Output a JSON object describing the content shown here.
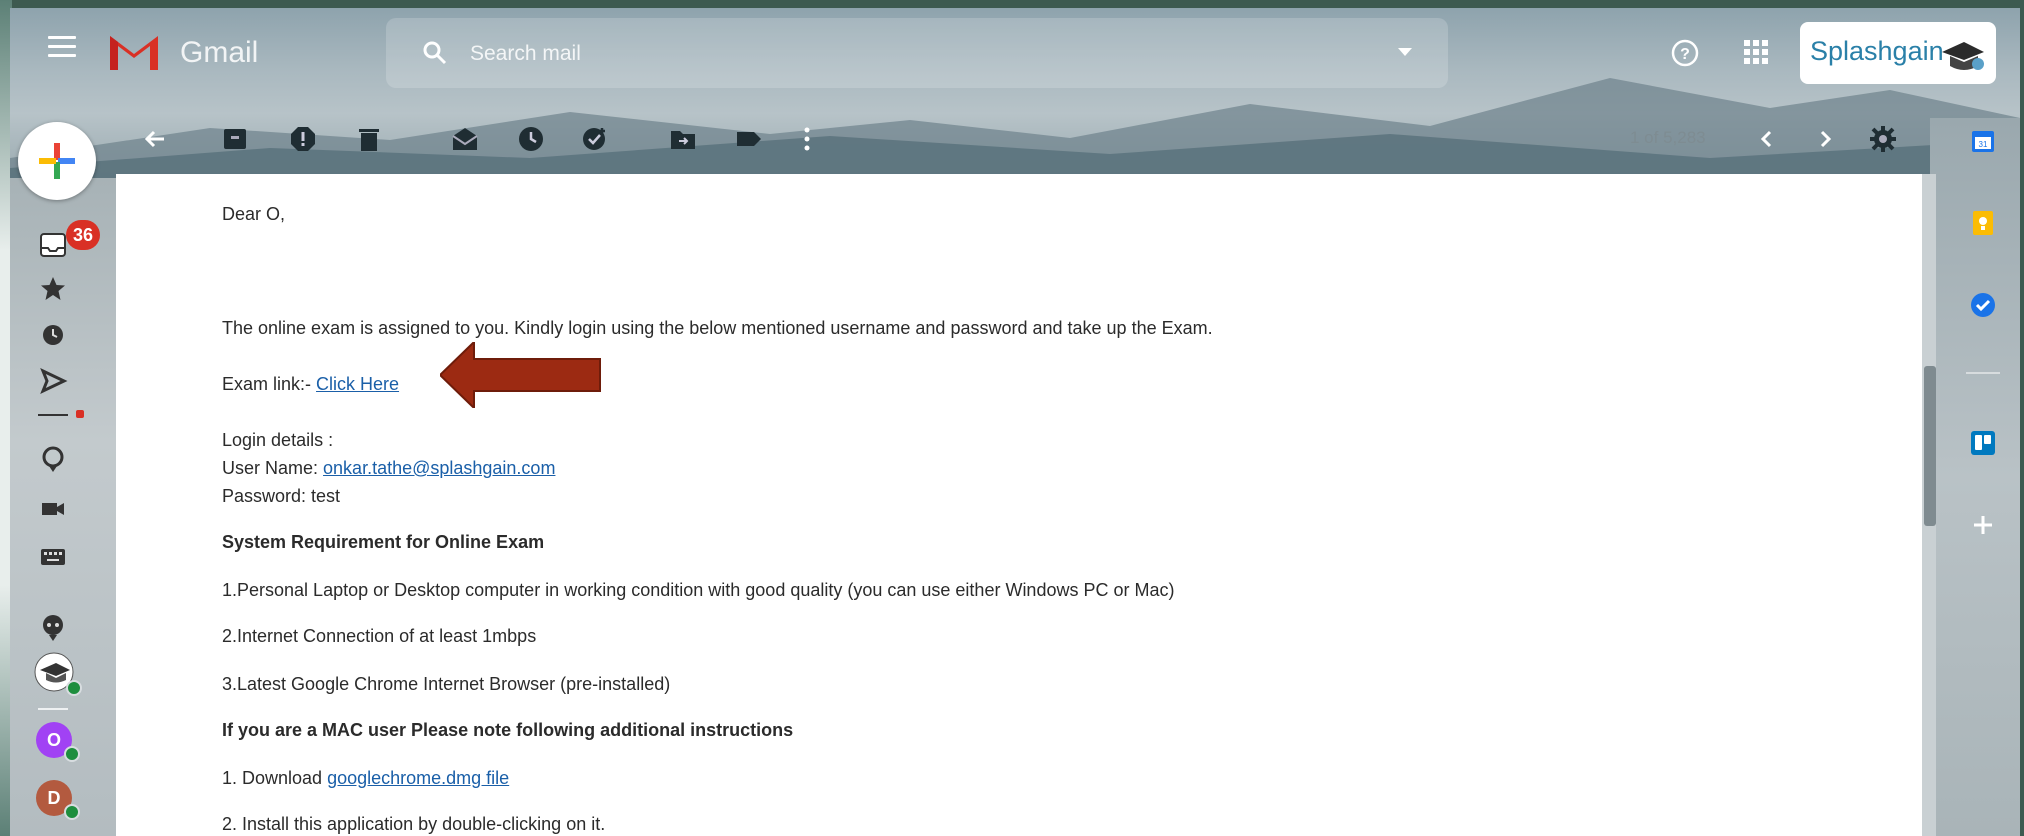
{
  "app": {
    "name": "Gmail",
    "search_placeholder": "Search mail",
    "account_brand": "Splashgain"
  },
  "toolbar": {
    "pager": "1 of 5,283",
    "icons": [
      "back-icon",
      "archive-icon",
      "report-spam-icon",
      "delete-icon",
      "mark-unread-icon",
      "snooze-icon",
      "add-task-icon",
      "move-to-icon",
      "label-icon",
      "more-icon"
    ]
  },
  "nav": {
    "inbox_badge": "36",
    "contacts": [
      {
        "initial": "O",
        "color": "#a142f4"
      },
      {
        "initial": "D",
        "color": "#b35a3f"
      }
    ]
  },
  "email": {
    "greeting": "Dear O,",
    "intro": "The online exam is assigned to you. Kindly login using the below mentioned username and password and take up the Exam.",
    "exam_link_label": "Exam link:- ",
    "exam_link_text": "Click Here",
    "login_heading": "Login details :",
    "username_label": "User Name: ",
    "username": "onkar.tathe@splashgain.com",
    "password_line": "Password: test",
    "sysreq_heading": "System Requirement for Online Exam",
    "sysreq": [
      "1.Personal Laptop or Desktop computer in working condition with good quality (you can use either Windows PC or Mac)",
      "2.Internet Connection of at least 1mbps",
      "3.Latest Google Chrome Internet Browser (pre-installed)"
    ],
    "mac_heading": "If you are a MAC user Please note following additional instructions",
    "mac_step1_label": "1. Download ",
    "mac_step1_link": "googlechrome.dmg file",
    "mac_step2": "2. Install this application by double-clicking on it."
  },
  "colors": {
    "arrow": "#9c2a12",
    "link": "#1a5fa8",
    "badge": "#d93025"
  }
}
